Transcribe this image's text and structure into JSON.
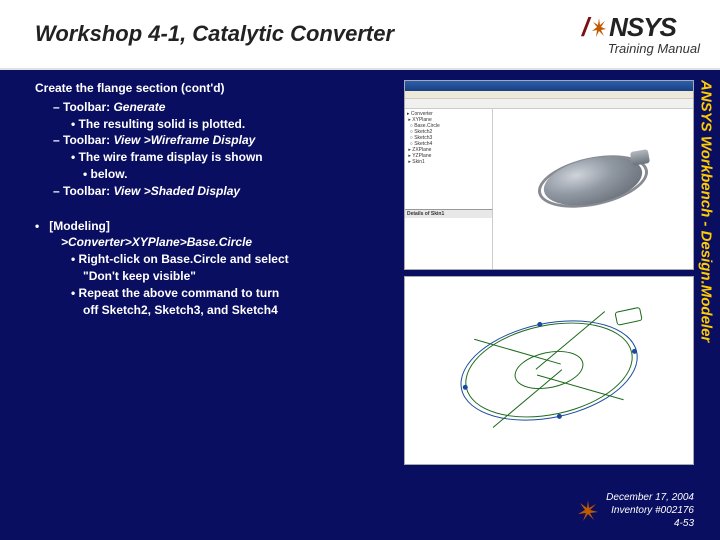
{
  "header": {
    "title": "Workshop 4-1, Catalytic Converter",
    "logo_a": "/",
    "logo_text": "NSYS",
    "training_manual": "Training Manual"
  },
  "content": {
    "s1_head": "Create the flange section (cont'd)",
    "s1_d1_pre": "Toolbar: ",
    "s1_d1_em": "Generate",
    "s1_b1": "The resulting solid is plotted.",
    "s1_d2_pre": "Toolbar: ",
    "s1_d2_em": "View >Wireframe Display",
    "s1_b2a": "The wire frame display is shown",
    "s1_b2b": "below.",
    "s1_d3_pre": "Toolbar: ",
    "s1_d3_em": "View >Shaded Display",
    "s2_modeling": "[Modeling]",
    "s2_path": ">Converter>XYPlane>Base.Circle",
    "s2_b1a": "Right-click on Base.Circle and select",
    "s2_b1b": "\"Don't keep visible\"",
    "s2_b2a": "Repeat the above command to turn",
    "s2_b2b": "off Sketch2, Sketch3, and Sketch4"
  },
  "side_text": "ANSYS Workbench - Design.Modeler",
  "footer": {
    "date": "December 17, 2004",
    "inventory": "Inventory #002176",
    "page": "4-53"
  },
  "screenshot": {
    "detail_head": "Details of Skin1"
  }
}
